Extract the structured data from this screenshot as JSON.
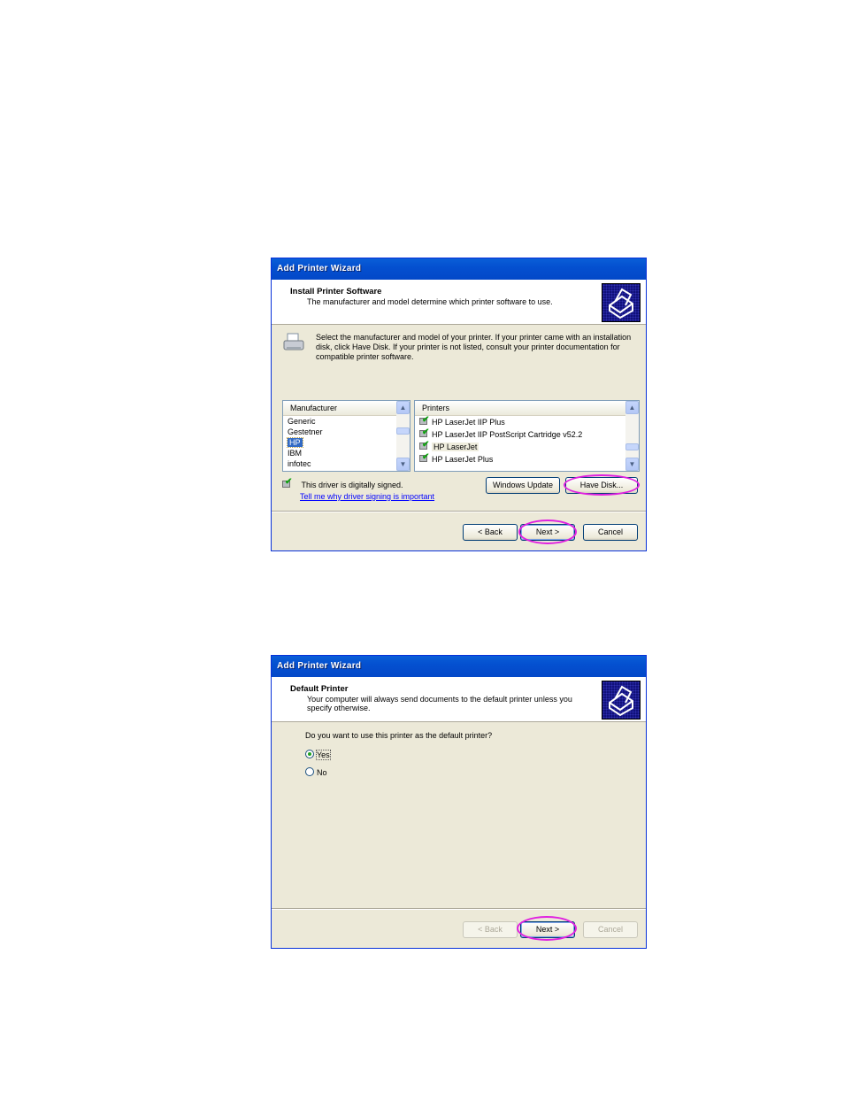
{
  "dialog1": {
    "title": "Add Printer Wizard",
    "header_title": "Install Printer Software",
    "header_subtitle": "The manufacturer and model determine which printer software to use.",
    "header_icon": "printer-wizard-icon",
    "instructions": "Select the manufacturer and model of your printer. If your printer came with an installation disk, click Have Disk. If your printer is not listed, consult your printer documentation for compatible printer software.",
    "manufacturer_list": {
      "header": "Manufacturer",
      "items": [
        "Generic",
        "Gestetner",
        "HP",
        "IBM",
        "infotec"
      ],
      "selected": "HP"
    },
    "printers_list": {
      "header": "Printers",
      "items": [
        "HP LaserJet IIP Plus",
        "HP LaserJet IIP PostScript Cartridge v52.2",
        "HP LaserJet",
        "HP LaserJet Plus"
      ],
      "selected": "HP LaserJet"
    },
    "signed_text": "This driver is digitally signed.",
    "signing_link": "Tell me why driver signing is important",
    "windows_update_label": "Windows Update",
    "have_disk_label": "Have Disk...",
    "back_label": "< Back",
    "next_label": "Next >",
    "cancel_label": "Cancel",
    "highlight_color": "#e020e0"
  },
  "dialog2": {
    "title": "Add Printer Wizard",
    "header_title": "Default Printer",
    "header_subtitle": "Your computer will always send documents to the default printer unless you specify otherwise.",
    "question": "Do you want to use this printer as the default printer?",
    "options": [
      {
        "label": "Yes",
        "checked": true
      },
      {
        "label": "No",
        "checked": false
      }
    ],
    "back_label": "< Back",
    "next_label": "Next >",
    "cancel_label": "Cancel"
  }
}
